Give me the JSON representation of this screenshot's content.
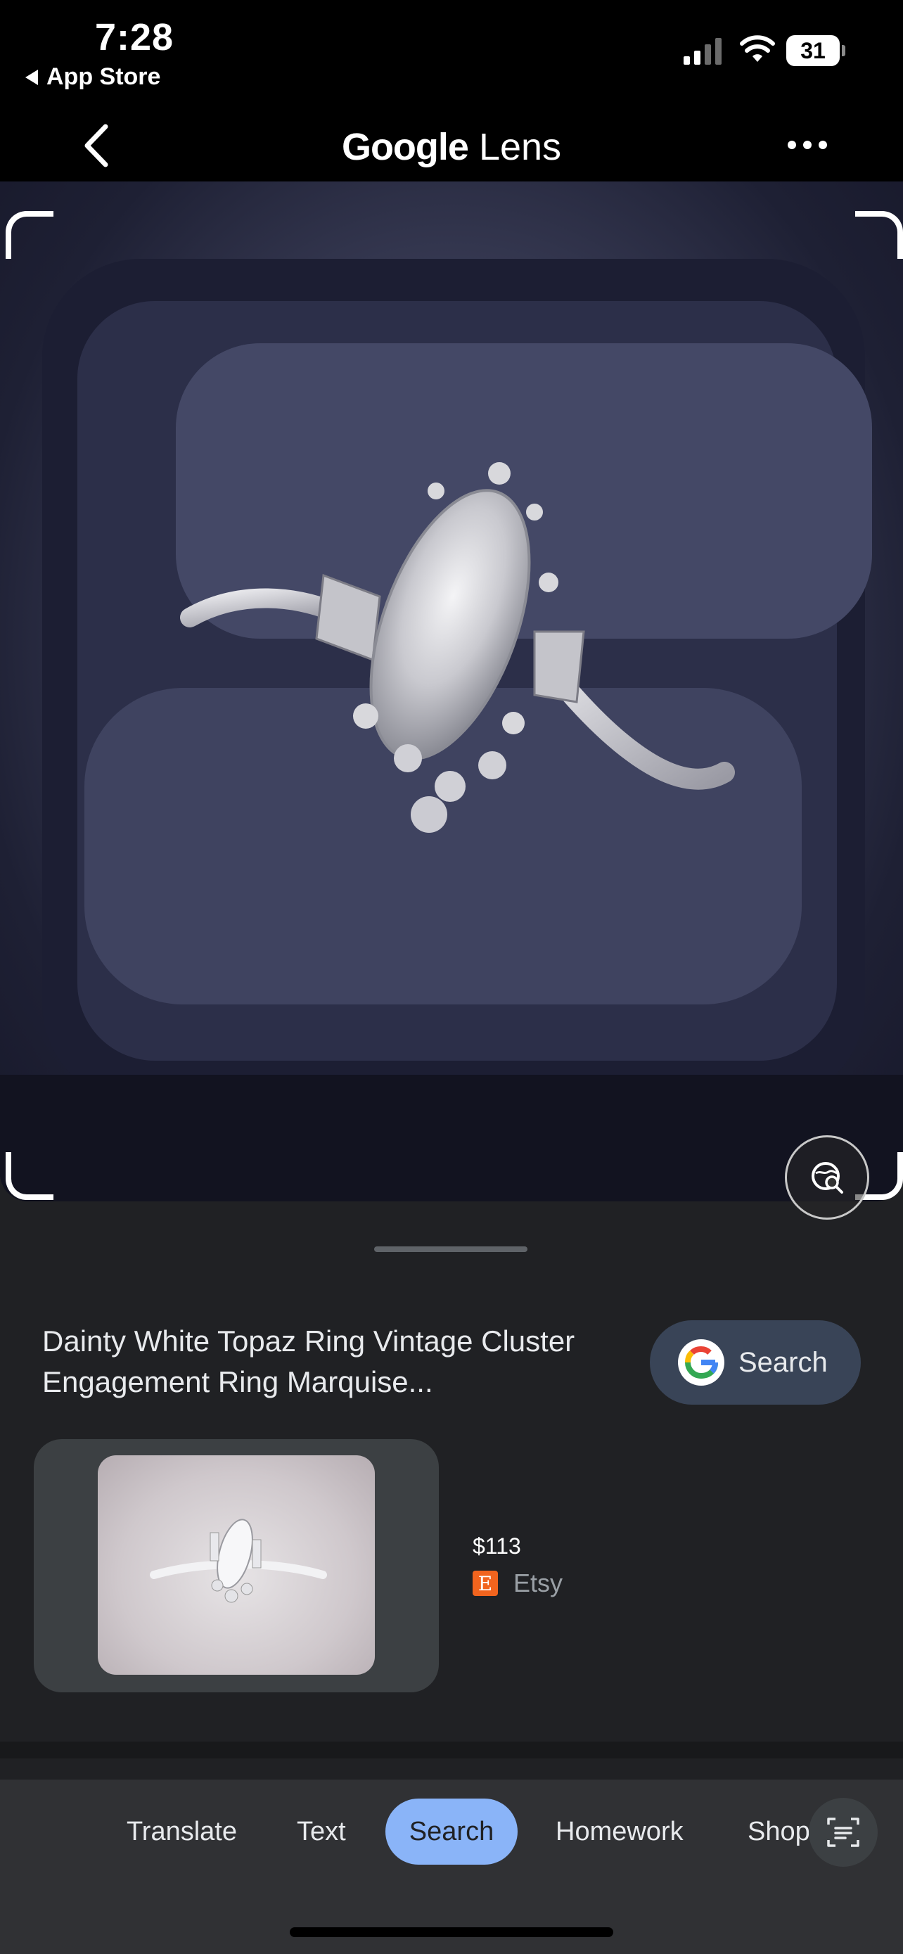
{
  "status_bar": {
    "time": "7:28",
    "back_app_label": "App Store",
    "battery_level": "31"
  },
  "header": {
    "title_brand": "Google",
    "title_product": "Lens"
  },
  "result": {
    "title": "Dainty White Topaz Ring Vintage Cluster Engagement Ring Marquise...",
    "search_button_label": "Search",
    "price": "$113",
    "seller": "Etsy",
    "seller_logo_letter": "E"
  },
  "tabs": [
    {
      "label": "Translate"
    },
    {
      "label": "Text"
    },
    {
      "label": "Search",
      "selected": true
    },
    {
      "label": "Homework"
    },
    {
      "label": "Shopping"
    }
  ],
  "colors": {
    "accent": "#8ab4f8",
    "background": "#202124",
    "etsy_orange": "#f1641e"
  }
}
